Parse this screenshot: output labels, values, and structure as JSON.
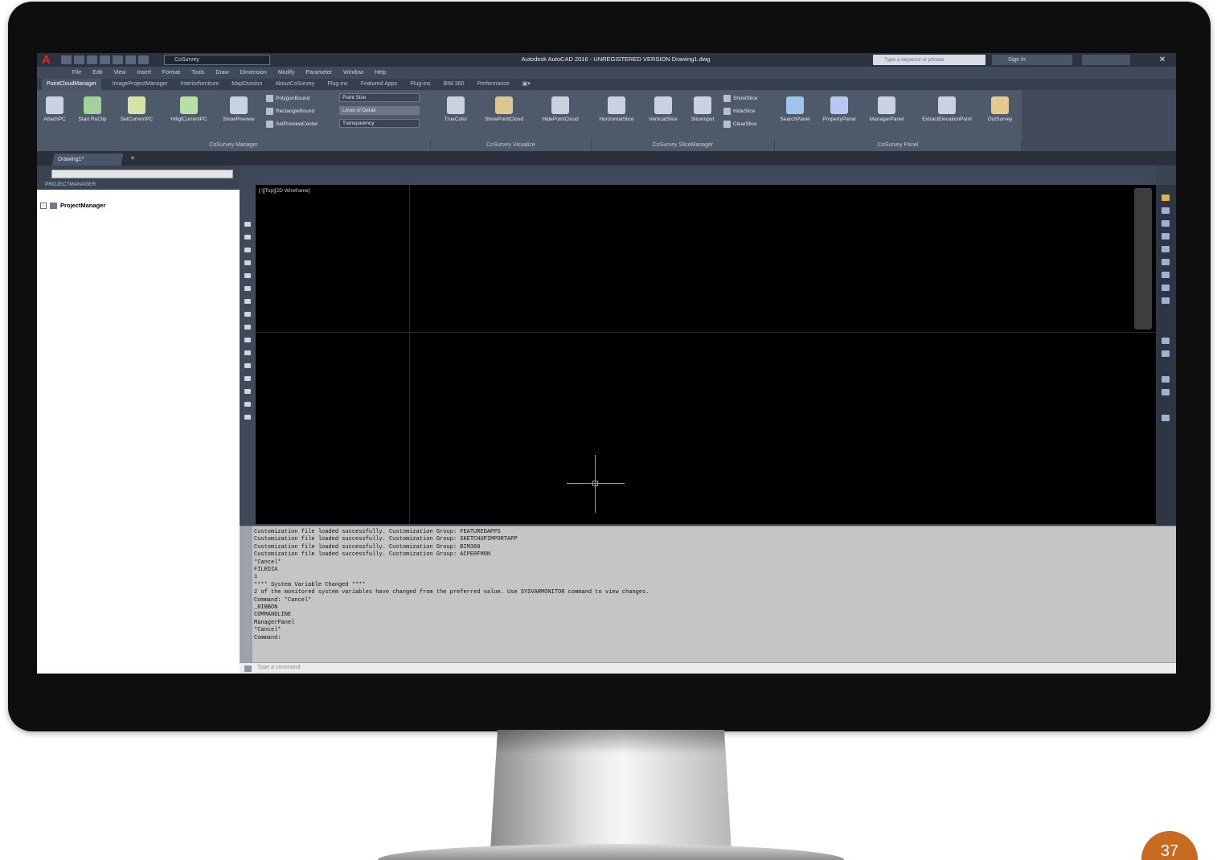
{
  "app": {
    "window_title": "Autodesk AutoCAD 2016 - UNREGISTERED VERSION   Drawing1.dwg",
    "workspace": "CoSurvey",
    "search_placeholder": "Type a keyword or phrase",
    "signin_label": "Sign In",
    "close_glyph": "✕"
  },
  "menubar": [
    "File",
    "Edit",
    "View",
    "Insert",
    "Format",
    "Tools",
    "Draw",
    "Dimension",
    "Modify",
    "Parameter",
    "Window",
    "Help"
  ],
  "ribbon_tabs": [
    "PointCloudManager",
    "ImageProjectManager",
    "Interiorfurniture",
    "MapDivision",
    "AboutCoSurvey",
    "Plug-ins",
    "Featured Apps",
    "Plug-ins",
    "BIM 360",
    "Performance",
    "▣▾"
  ],
  "ribbon_tools": {
    "manager": [
      "AttachPC",
      "Start RoClip",
      "SetCurrentPC",
      "HiligtCurrentPC",
      "ShowPreview"
    ],
    "manager_small": [
      "PolygonBound",
      "RectangleBound",
      "SetPreviewCenter"
    ],
    "props": [
      "Point Size",
      "Level of Detail",
      "Transparency"
    ],
    "visualize": [
      "TrueColor",
      "ShowPointCloud",
      "HidePointCloud",
      "HorizontalSlice",
      "VerticalSlice",
      "SliceInput"
    ],
    "slice_small": [
      "ShowSlice",
      "HideSlice",
      "ClearSlice"
    ],
    "panel": [
      "SearchPanel",
      "PropertyPanel",
      "ManagerPanel",
      "ExtractElevationPoint",
      "OutSurvey"
    ]
  },
  "ribbon_groups": [
    "CoSurvey Manager",
    "CoSurvey Visualize",
    "CoSurvey SliceManager",
    "CoSurvey Panel"
  ],
  "file_tab": "Drawing1*",
  "tab_plus": "+",
  "project_manager": {
    "search_text": "",
    "title": "PROJECTMANAGER",
    "root_node": "ProjectManager",
    "toggle": "-"
  },
  "viewport_label": "[-][Top][2D Wireframe]",
  "command_history": [
    "Customization file loaded successfully. Customization Group: FEATUREDAPPS",
    "Customization file loaded successfully. Customization Group: SKETCHUPIMPORTAPP",
    "Customization file loaded successfully. Customization Group: BIM360",
    "Customization file loaded successfully. Customization Group: ACPERFMON",
    "*Cancel*",
    "FILEDIA",
    "1",
    "**** System Variable Changed ****",
    "2 of the monitored system variables have changed from the preferred value. Use SYSVARMONITOR command to view changes.",
    "Command: *Cancel*",
    "_RIBBON",
    "COMMANDLINE",
    "ManagerPanel",
    "*Cancel*",
    "Command:"
  ],
  "command_placeholder": "Type a command",
  "page_number": "37",
  "colors": {
    "bezel": "#0e0e0e",
    "ribbon": "#4e596a",
    "drawing_bg": "#000000",
    "command_bg": "#c5c5c5",
    "badge": "#c96a21"
  }
}
